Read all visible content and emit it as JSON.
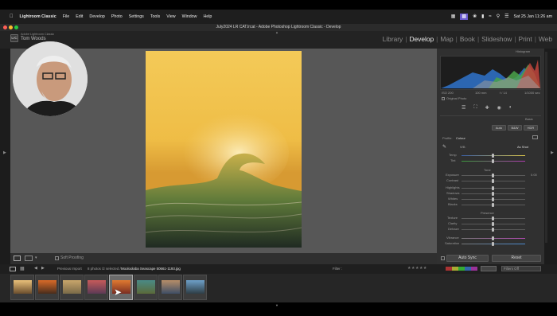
{
  "menubar": {
    "apple": "",
    "app": "Lightroom Classic",
    "items": [
      "File",
      "Edit",
      "Develop",
      "Photo",
      "Settings",
      "Tools",
      "View",
      "Window",
      "Help"
    ],
    "datetime": "Sat 25 Jan  11:26 am"
  },
  "window": {
    "title": "July2024 LR CAT.lrcat - Adobe Photoshop Lightroom Classic - Develop"
  },
  "identity": {
    "logo": "LrC",
    "line1": "Adobe Lightroom Classic",
    "line2": "Tom Woods"
  },
  "modules": [
    "Library",
    "Develop",
    "Map",
    "Book",
    "Slideshow",
    "Print",
    "Web"
  ],
  "active_module": "Develop",
  "toolbar": {
    "soft_proofing": "Soft Proofing"
  },
  "right_panel": {
    "histogram_label": "Histogram",
    "histogram_readout": [
      "ISO 200",
      "100 mm",
      "f / 14",
      "1/1000 sec"
    ],
    "original_photo": "Original Photo",
    "basic_label": "Basic",
    "treatment": [
      "Auto",
      "B&W",
      "HDR"
    ],
    "profile_label": "Profile:",
    "profile_value": "Colour",
    "wb_label": "WB:",
    "wb_value": "As Shot",
    "wb_sliders": [
      "Temp",
      "Tint"
    ],
    "tone_label": "Tone",
    "tone_sliders": [
      "Exposure",
      "Contrast",
      "Highlights",
      "Shadows",
      "Whites",
      "Blacks"
    ],
    "exposure_value": "0.00",
    "presence_label": "Presence",
    "presence_sliders": [
      "Texture",
      "Clarity",
      "Dehaze"
    ],
    "color_sliders": [
      "Vibrance",
      "Saturation"
    ],
    "auto_sync": "Auto Sync",
    "reset": "Reset"
  },
  "filmstrip": {
    "source_label": "Previous Import",
    "count_text": "8 photos /2 selected /",
    "filename": "Mooloolaba Seascape 50661-1193.jpg",
    "filter_label": "Filter :",
    "filters_off": "Filters Off",
    "thumbs": [
      {
        "c1": "#e9c07a",
        "c2": "#6b4e2e"
      },
      {
        "c1": "#d86a28",
        "c2": "#4a2d1c"
      },
      {
        "c1": "#c9a66b",
        "c2": "#7a6a48"
      },
      {
        "c1": "#c65a5a",
        "c2": "#5c3a55"
      },
      {
        "c1": "#e07a30",
        "c2": "#7a2e22"
      },
      {
        "c1": "#4a8a86",
        "c2": "#5a6a3a"
      },
      {
        "c1": "#b78e68",
        "c2": "#3e4e66"
      },
      {
        "c1": "#6ea0c8",
        "c2": "#2e3e46"
      }
    ]
  },
  "colors": {
    "active": "#e9e9e9",
    "inactive": "#8d8d8d",
    "panel": "#303030",
    "canvas": "#575757"
  }
}
